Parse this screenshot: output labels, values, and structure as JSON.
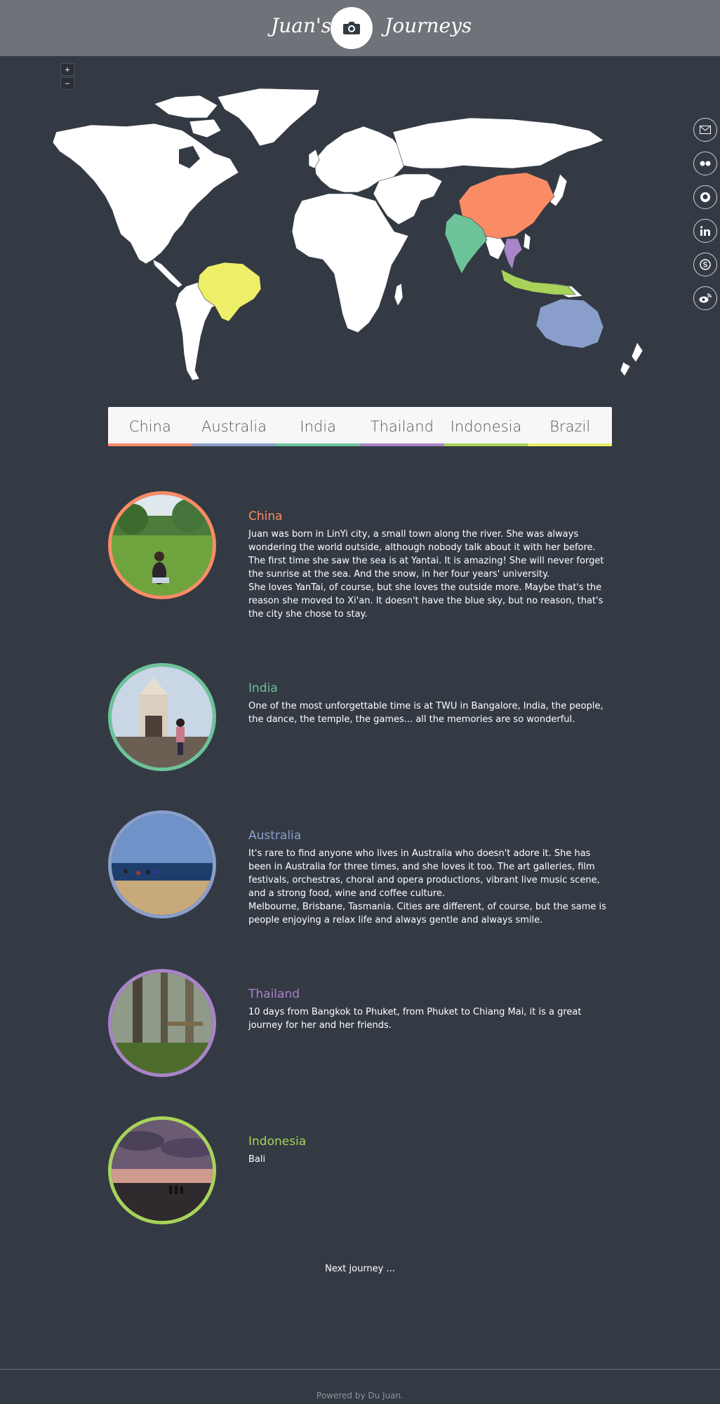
{
  "header": {
    "brand_left": "Juan's",
    "brand_right": "Journeys",
    "logo_icon": "camera-icon"
  },
  "map": {
    "zoom_in_label": "+",
    "zoom_out_label": "−",
    "highlight_colors": {
      "China": "#fa8c65",
      "India": "#6cc39a",
      "Australia": "#8a9ecb",
      "Thailand": "#a884c8",
      "Indonesia": "#a8d35a",
      "Brazil": "#eeee68"
    },
    "land_color": "#ffffff"
  },
  "social": [
    {
      "name": "email-icon"
    },
    {
      "name": "flickr-icon"
    },
    {
      "name": "github-icon"
    },
    {
      "name": "linkedin-icon"
    },
    {
      "name": "skype-icon"
    },
    {
      "name": "weibo-icon"
    }
  ],
  "tabs": [
    {
      "label": "China",
      "color": "#fa8c65"
    },
    {
      "label": "Australia",
      "color": "#8a9ecb"
    },
    {
      "label": "India",
      "color": "#6cc39a"
    },
    {
      "label": "Thailand",
      "color": "#a884c8"
    },
    {
      "label": "Indonesia",
      "color": "#a8d35a"
    },
    {
      "label": "Brazil",
      "color": "#eeee68"
    }
  ],
  "stories": [
    {
      "title": "China",
      "color": "#fa8c65",
      "paragraphs": [
        "Juan was born in LinYi city, a small town along the river. She was always wondering the world outside, although nobody talk about it with her before.",
        "The first time she saw the sea is at Yantai. It is amazing! She will never forget the sunrise at the sea. And the snow, in her four years' university.",
        "She loves YanTai, of course, but she loves the outside more. Maybe that's the reason she moved to Xi'an. It doesn't have the blue sky, but no reason, that's the city she chose to stay."
      ]
    },
    {
      "title": "India",
      "color": "#6cc39a",
      "paragraphs": [
        "One of the most unforgettable time is at TWU in Bangalore, India, the people, the dance, the temple, the games... all the memories are so wonderful."
      ]
    },
    {
      "title": "Australia",
      "color": "#8a9ecb",
      "paragraphs": [
        "It's rare to find anyone who lives in Australia who doesn't adore it. She has been in Australia for three times, and she loves it too. The art galleries, film festivals, orchestras, choral and opera productions, vibrant live music scene, and a strong food, wine and coffee culture.",
        "Melbourne, Brisbane, Tasmania. Cities are different, of course, but the same is people enjoying a relax life and always gentle and always smile."
      ]
    },
    {
      "title": "Thailand",
      "color": "#a884c8",
      "paragraphs": [
        "10 days from Bangkok to Phuket, from Phuket to Chiang Mai, it is a great journey for her and her friends."
      ]
    },
    {
      "title": "Indonesia",
      "color": "#a8d35a",
      "paragraphs": [
        "Bali"
      ]
    }
  ],
  "next_label": "Next journey ...",
  "footer_text": "Powered by Du Juan."
}
